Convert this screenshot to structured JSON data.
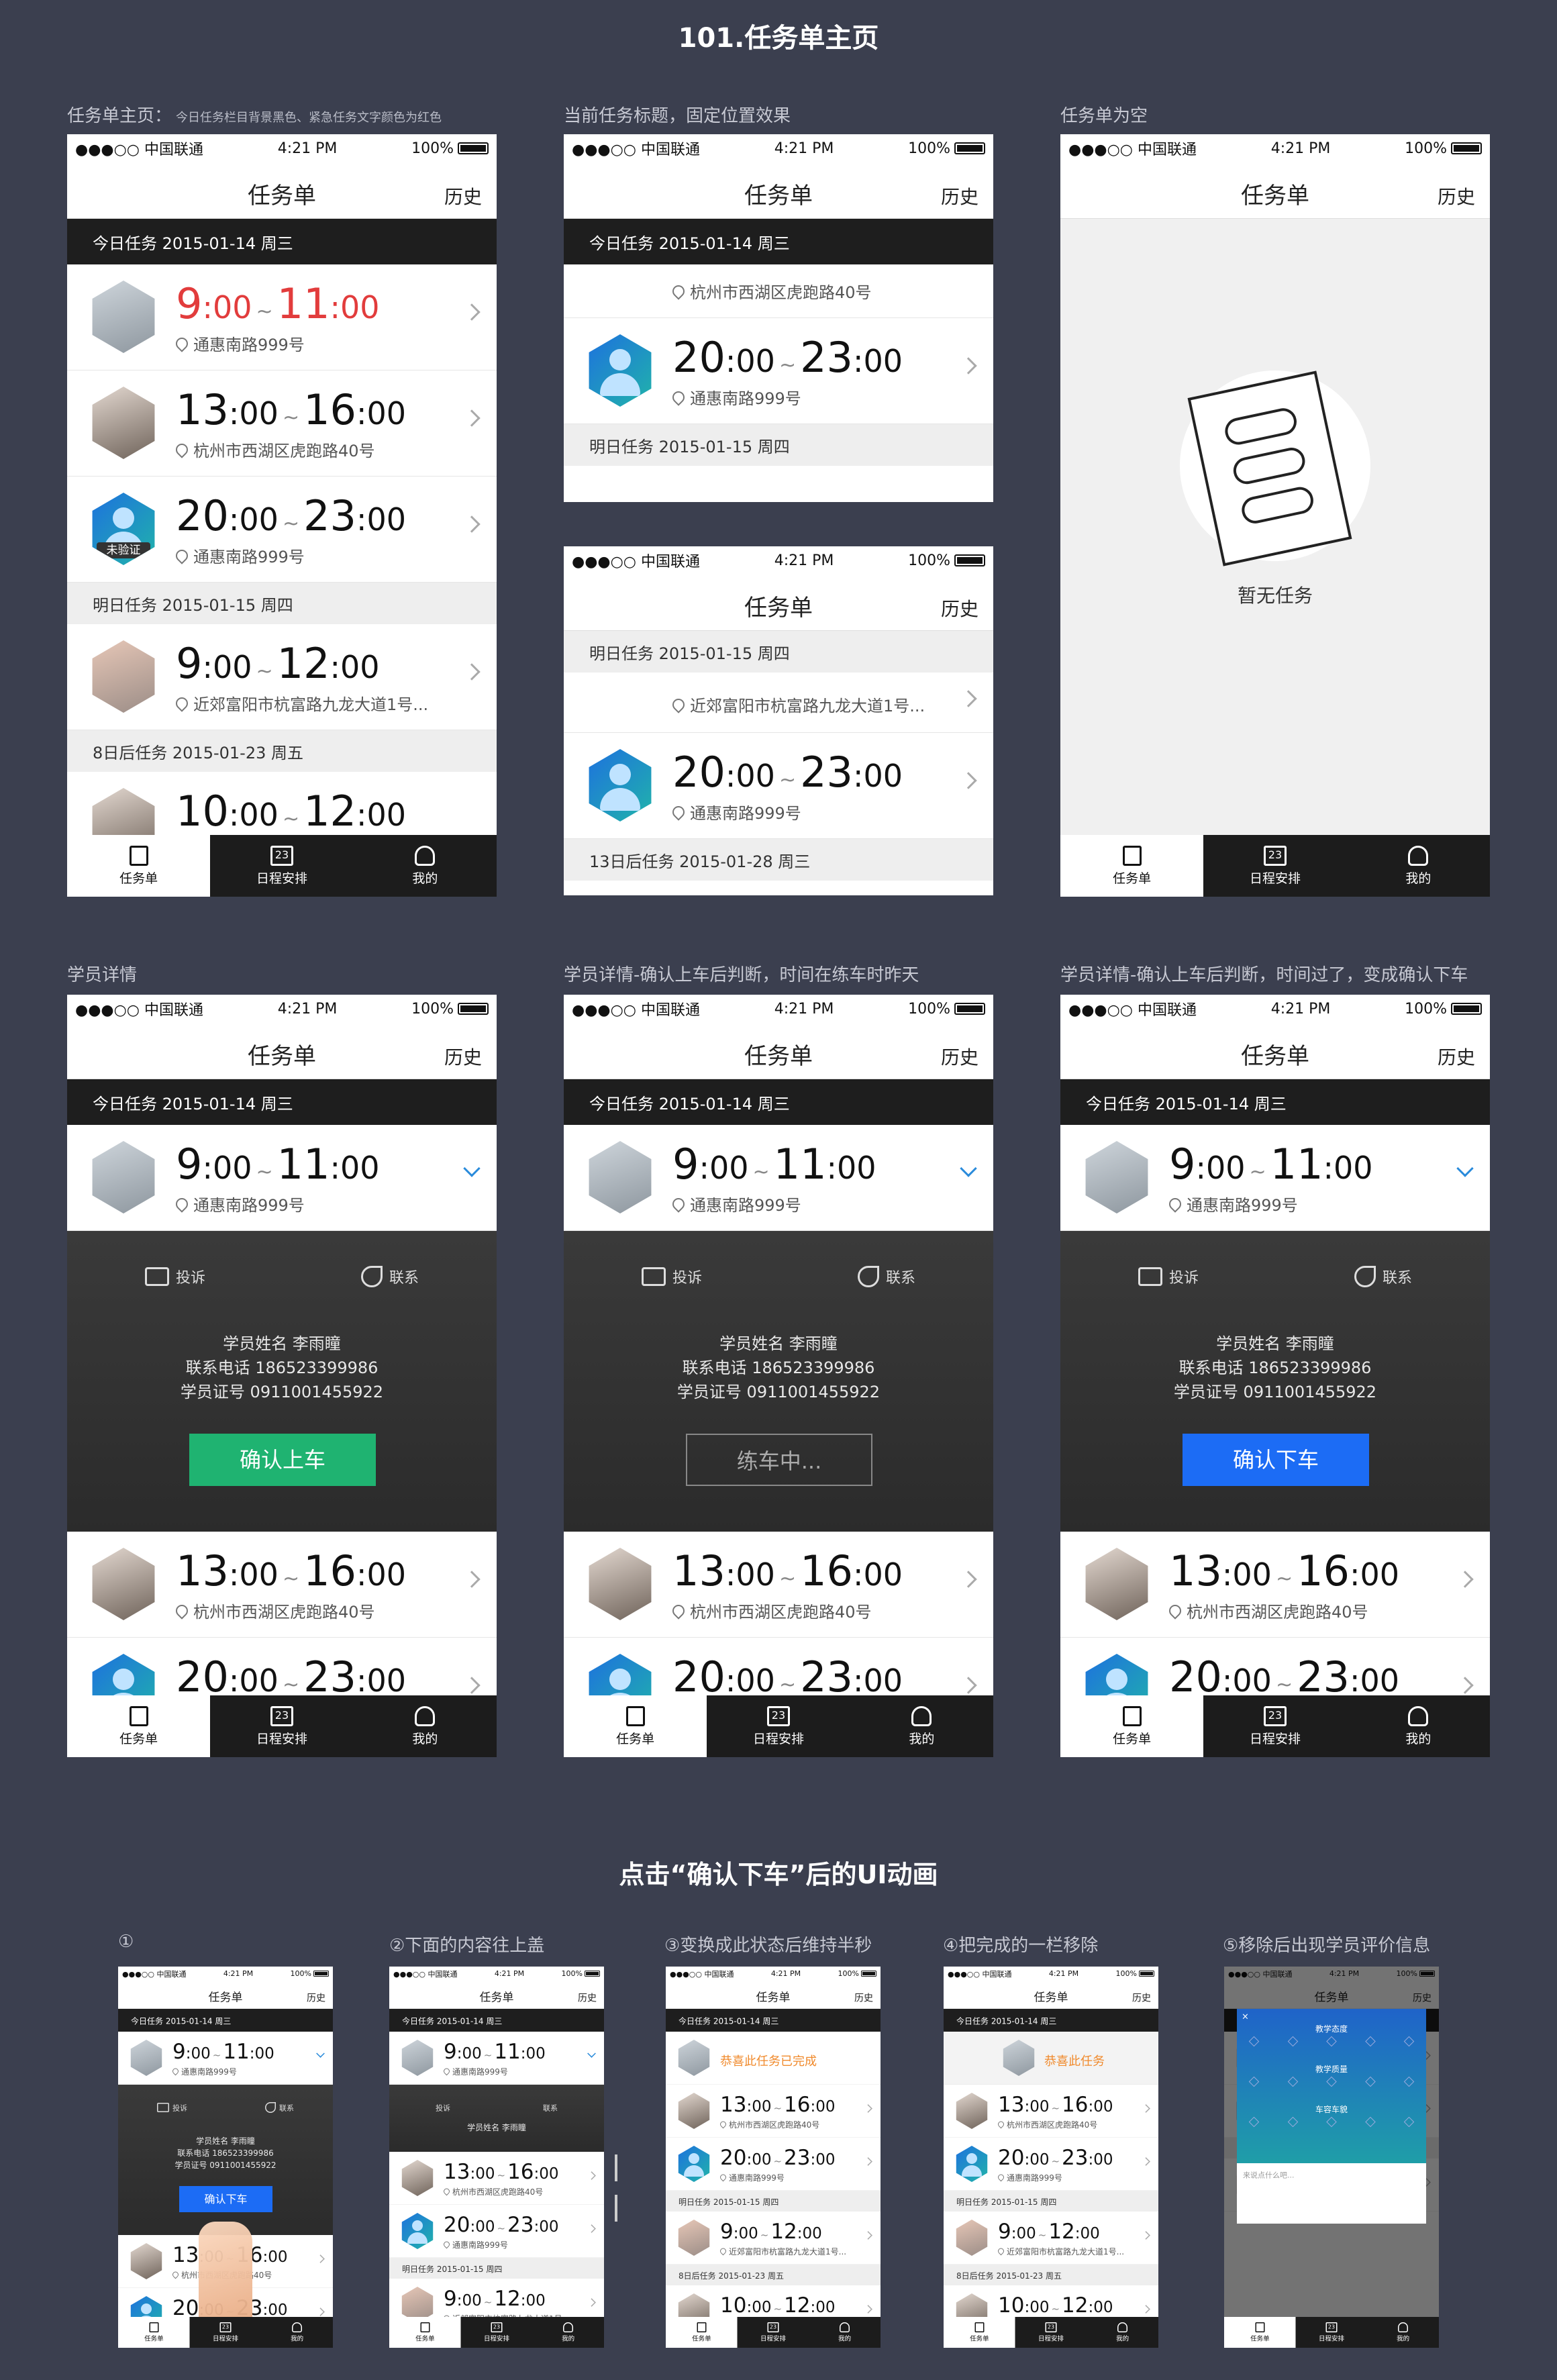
{
  "page": {
    "title": "101.任务单主页",
    "section2_title": "点击“确认下车”后的UI动画"
  },
  "captions": {
    "c1": "任务单主页：",
    "c1_note": "今日任务栏目背景黑色、紧急任务文字颜色为红色",
    "c2": "当前任务标题，固定位置效果",
    "c3": "任务单为空",
    "c4": "学员详情",
    "c5": "学员详情-确认上车后判断，时间在练车时昨天",
    "c6": "学员详情-确认上车后判断，时间过了，变成确认下车",
    "s1": "①",
    "s2": "②下面的内容往上盖",
    "s3": "③变换成此状态后维持半秒",
    "s4": "④把完成的一栏移除",
    "s5": "⑤移除后出现学员评价信息"
  },
  "status": {
    "carrier": "●●●○○ 中国联通",
    "time": "4:21 PM",
    "battery": "100%"
  },
  "nav": {
    "title": "任务单",
    "history": "历史"
  },
  "sections": {
    "today": "今日任务  2015-01-14 周三",
    "tomorrow": "明日任务  2015-01-15 周四",
    "day8": "8日后任务  2015-01-23 周五",
    "day13": "13日后任务  2015-01-28 周三"
  },
  "tasks": [
    {
      "start_h": "9",
      "start_m": ":00",
      "end_h": "11",
      "end_m": ":00",
      "address": "通惠南路999号"
    },
    {
      "start_h": "13",
      "start_m": ":00",
      "end_h": "16",
      "end_m": ":00",
      "address": "杭州市西湖区虎跑路40号"
    },
    {
      "start_h": "20",
      "start_m": ":00",
      "end_h": "23",
      "end_m": ":00",
      "address": "通惠南路999号",
      "badge": "未验证"
    },
    {
      "start_h": "9",
      "start_m": ":00",
      "end_h": "12",
      "end_m": ":00",
      "address": "近郊富阳市杭富路九龙大道1号..."
    },
    {
      "start_h": "10",
      "start_m": ":00",
      "end_h": "12",
      "end_m": ":00",
      "address": ""
    }
  ],
  "tilde": "~",
  "tabs": {
    "tasks": "任务单",
    "schedule": "日程安排",
    "mine": "我的",
    "cal_num": "23"
  },
  "empty": {
    "text": "暂无任务"
  },
  "detail": {
    "complain": "投诉",
    "contact": "联系",
    "name": "学员姓名  李雨瞳",
    "phone": "联系电话  186523399986",
    "idno": "学员证号  0911001455922",
    "btn_board": "确认上车",
    "btn_training": "练车中...",
    "btn_alight": "确认下车"
  },
  "anim": {
    "done": "恭喜此任务已完成",
    "done_short": "恭喜此任务",
    "eval_teach": "教学态度",
    "eval_quality": "教学质量",
    "eval_car": "车容车貌",
    "eval_ph": "来说点什么吧..."
  },
  "colors": {
    "bg": "#3b3f4f",
    "red": "#e23c3c",
    "green": "#1fb371",
    "blue": "#1c6cf5"
  }
}
